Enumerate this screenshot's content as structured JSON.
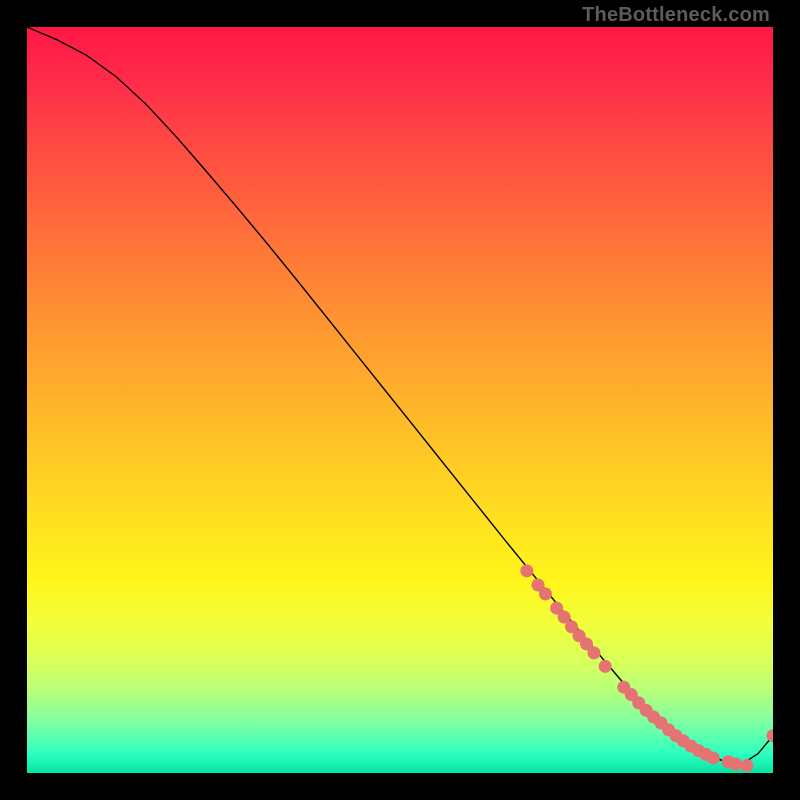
{
  "attribution": "TheBottleneck.com",
  "colors": {
    "dot": "#e57373",
    "curve": "#000000"
  },
  "chart_data": {
    "type": "line",
    "title": "",
    "xlabel": "",
    "ylabel": "",
    "xlim": [
      0,
      100
    ],
    "ylim": [
      0,
      100
    ],
    "grid": false,
    "series": [
      {
        "name": "bottleneck-curve",
        "x": [
          0,
          4,
          8,
          12,
          16,
          20,
          24,
          28,
          32,
          36,
          40,
          44,
          48,
          52,
          56,
          60,
          64,
          68,
          72,
          76,
          80,
          82,
          84,
          86,
          88,
          90,
          92,
          94,
          96,
          98,
          100
        ],
        "y": [
          100,
          98.3,
          96.2,
          93.3,
          89.6,
          85.3,
          80.7,
          76.0,
          71.2,
          66.3,
          61.3,
          56.3,
          51.3,
          46.3,
          41.3,
          36.3,
          31.3,
          26.4,
          21.5,
          16.7,
          12.0,
          9.9,
          7.9,
          6.1,
          4.5,
          3.1,
          2.1,
          1.4,
          1.3,
          2.6,
          5.0
        ]
      }
    ],
    "markers": {
      "name": "highlighted-points",
      "x": [
        67,
        68.5,
        69.5,
        71,
        72,
        73,
        74,
        75,
        76,
        77.5,
        80,
        81,
        82,
        83,
        84,
        85,
        86,
        87,
        88,
        89,
        90,
        91,
        92,
        94,
        95,
        96.5,
        100
      ],
      "y": [
        27.1,
        25.2,
        24.0,
        22.1,
        20.9,
        19.6,
        18.4,
        17.3,
        16.1,
        14.3,
        11.5,
        10.5,
        9.4,
        8.4,
        7.5,
        6.7,
        5.8,
        5.0,
        4.3,
        3.6,
        3.0,
        2.5,
        2.0,
        1.5,
        1.2,
        1.0,
        5.0
      ]
    }
  }
}
